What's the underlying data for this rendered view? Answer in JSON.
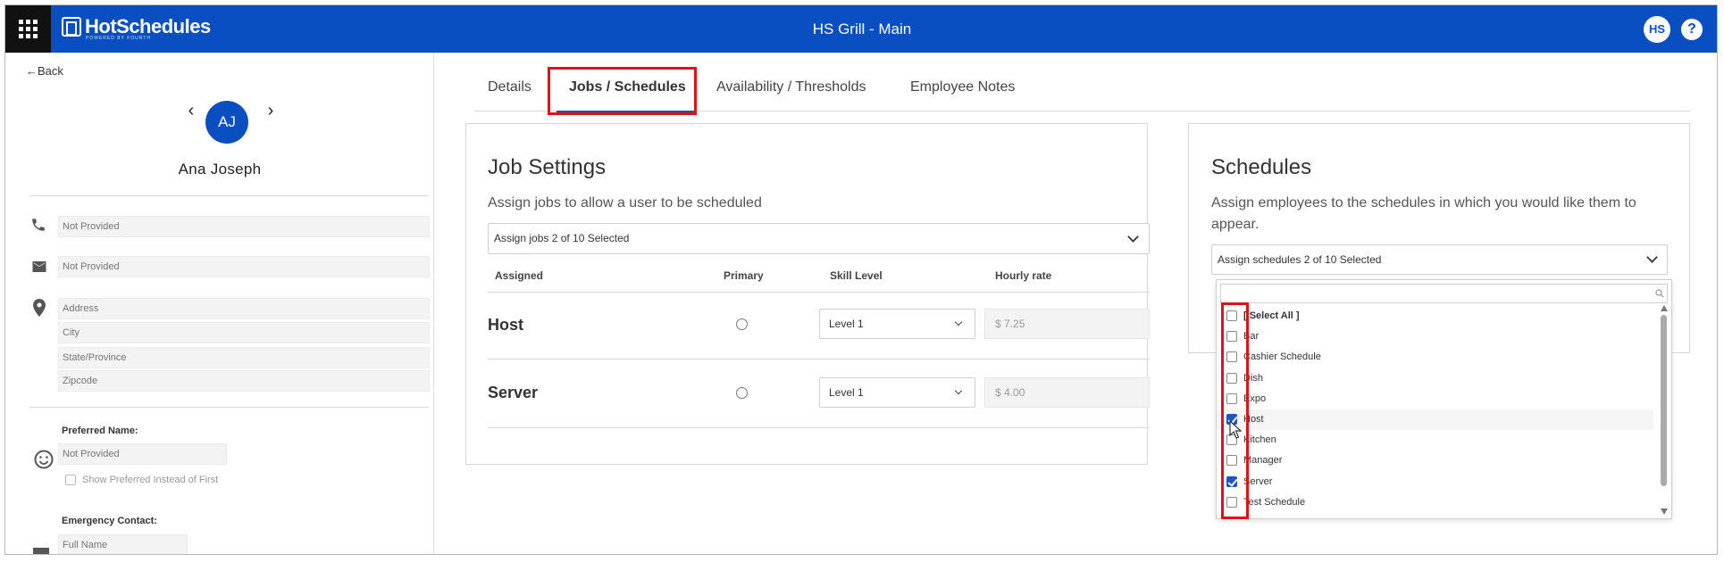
{
  "header": {
    "logo_text": "HotSchedules",
    "logo_sub": "POWERED BY FOURTH",
    "title": "HS Grill - Main",
    "user_initials": "HS",
    "help_label": "?"
  },
  "profile": {
    "back_label": "Back",
    "initials": "AJ",
    "name": "Ana Joseph",
    "phone_placeholder": "Not Provided",
    "email_placeholder": "Not Provided",
    "address_placeholder": "Address",
    "city_placeholder": "City",
    "state_placeholder": "State/Province",
    "zip_placeholder": "Zipcode",
    "preferred_name_label": "Preferred Name:",
    "preferred_name_placeholder": "Not Provided",
    "show_preferred_label": "Show Preferred Instead of First",
    "emergency_label": "Emergency Contact:",
    "emergency_placeholder": "Full Name"
  },
  "tabs": [
    {
      "label": "Details"
    },
    {
      "label": "Jobs / Schedules"
    },
    {
      "label": "Availability / Thresholds"
    },
    {
      "label": "Employee Notes"
    }
  ],
  "job_settings": {
    "title": "Job Settings",
    "subtitle": "Assign jobs to allow a user to be scheduled",
    "assign_label": "Assign jobs 2 of 10 Selected",
    "columns": [
      "Assigned",
      "Primary",
      "Skill Level",
      "Hourly rate"
    ],
    "rows": [
      {
        "job": "Host",
        "level": "Level 1",
        "rate": "$ 7.25"
      },
      {
        "job": "Server",
        "level": "Level 1",
        "rate": "$ 4.00"
      }
    ]
  },
  "schedules": {
    "title": "Schedules",
    "subtitle_line1": "Assign employees to the schedules in which you would like them to",
    "subtitle_line2": "appear.",
    "assign_label": "Assign schedules 2 of 10 Selected",
    "items": [
      {
        "label": "[ Select All ]",
        "checked": false
      },
      {
        "label": "Bar",
        "checked": false
      },
      {
        "label": "Cashier Schedule",
        "checked": false
      },
      {
        "label": "Dish",
        "checked": false
      },
      {
        "label": "Expo",
        "checked": false
      },
      {
        "label": "Host",
        "checked": true
      },
      {
        "label": "Kitchen",
        "checked": false
      },
      {
        "label": "Manager",
        "checked": false
      },
      {
        "label": "Server",
        "checked": true
      },
      {
        "label": "Test Schedule",
        "checked": false
      }
    ]
  },
  "colors": {
    "brand_blue": "#0a4fc2",
    "highlight_red": "#d9141b",
    "checkbox_blue": "#1d55c4"
  }
}
